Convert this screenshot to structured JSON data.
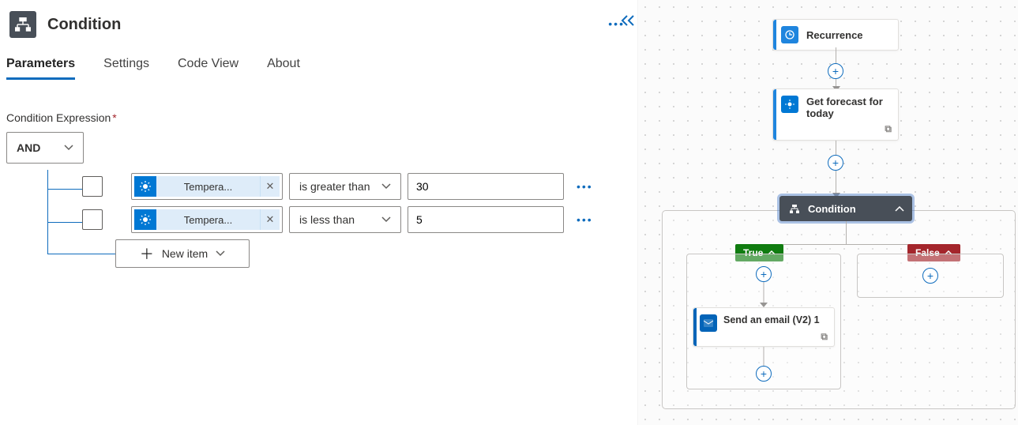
{
  "header": {
    "title": "Condition"
  },
  "tabs": {
    "parameters": "Parameters",
    "settings": "Settings",
    "codeview": "Code View",
    "about": "About"
  },
  "section": {
    "label": "Condition Expression",
    "required": "*"
  },
  "logic": {
    "operator": "AND"
  },
  "rules": [
    {
      "chip": "Tempera...",
      "op": "is greater than",
      "value": "30"
    },
    {
      "chip": "Tempera...",
      "op": "is less than",
      "value": "5"
    }
  ],
  "newitem": {
    "label": "New item"
  },
  "canvas": {
    "recurrence": "Recurrence",
    "forecast": "Get forecast for today",
    "condition": "Condition",
    "true_label": "True",
    "false_label": "False",
    "email": "Send an email (V2) 1"
  }
}
